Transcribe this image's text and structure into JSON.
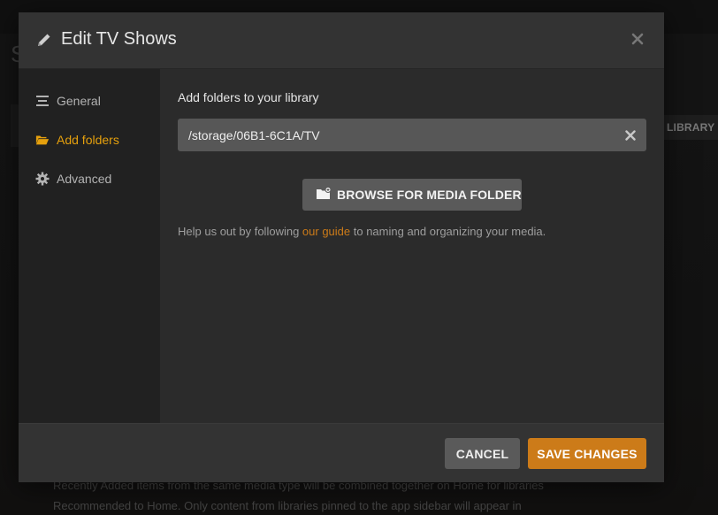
{
  "background": {
    "heading_letter": "S",
    "library_tab": "LIBRARY",
    "note_line1": "Recently Added items from the same media type will be combined together on Home for libraries",
    "note_line2": "Recommended to Home. Only content from libraries pinned to the app sidebar will appear in"
  },
  "modal": {
    "title": "Edit TV Shows",
    "title_icon": "pencil-icon",
    "close_icon": "close-icon"
  },
  "sidebar": {
    "items": [
      {
        "label": "General",
        "icon": "general-lines-icon",
        "active": false
      },
      {
        "label": "Add folders",
        "icon": "folder-open-icon",
        "active": true
      },
      {
        "label": "Advanced",
        "icon": "gear-icon",
        "active": false
      }
    ]
  },
  "content": {
    "section_label": "Add folders to your library",
    "folder_path": "/storage/06B1-6C1A/TV",
    "browse_button": "BROWSE FOR MEDIA FOLDER",
    "help_prefix": "Help us out by following ",
    "help_link": "our guide",
    "help_suffix": " to naming and organizing your media."
  },
  "footer": {
    "cancel_label": "CANCEL",
    "save_label": "SAVE CHANGES"
  },
  "colors": {
    "accent": "#e5a00d",
    "save_button": "#cc7b19",
    "link": "#cc7b19"
  }
}
